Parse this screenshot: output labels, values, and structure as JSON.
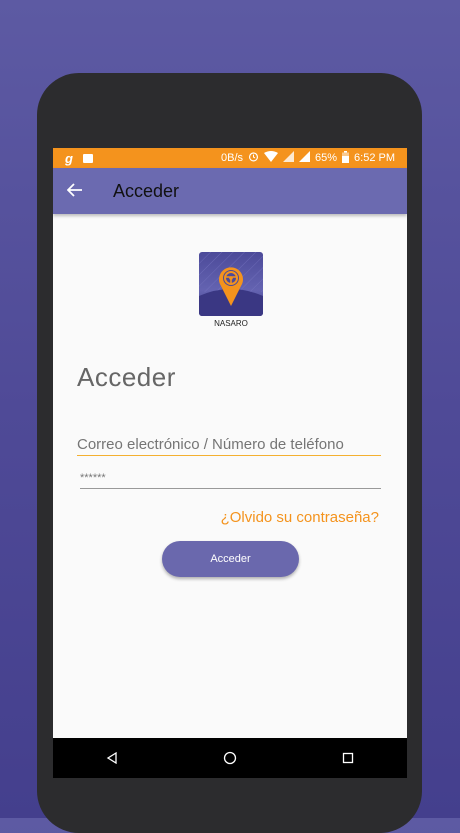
{
  "status_bar": {
    "left_glyph": "g",
    "data_rate": "0B/s",
    "battery": "65%",
    "time": "6:52 PM",
    "color": "#f4931d"
  },
  "toolbar": {
    "title": "Acceder",
    "color": "#6b6ab0"
  },
  "logo": {
    "name": "NASARO"
  },
  "form": {
    "heading": "Acceder",
    "email_placeholder": "Correo electrónico / Número de teléfono",
    "password_value": "******",
    "forgot_label": "¿Olvido su contraseña?",
    "submit_label": "Acceder"
  },
  "navbar": {
    "icons": [
      "back-icon",
      "home-icon",
      "recents-icon"
    ]
  },
  "colors": {
    "accent": "#f4931d",
    "primary": "#6a68ad"
  }
}
